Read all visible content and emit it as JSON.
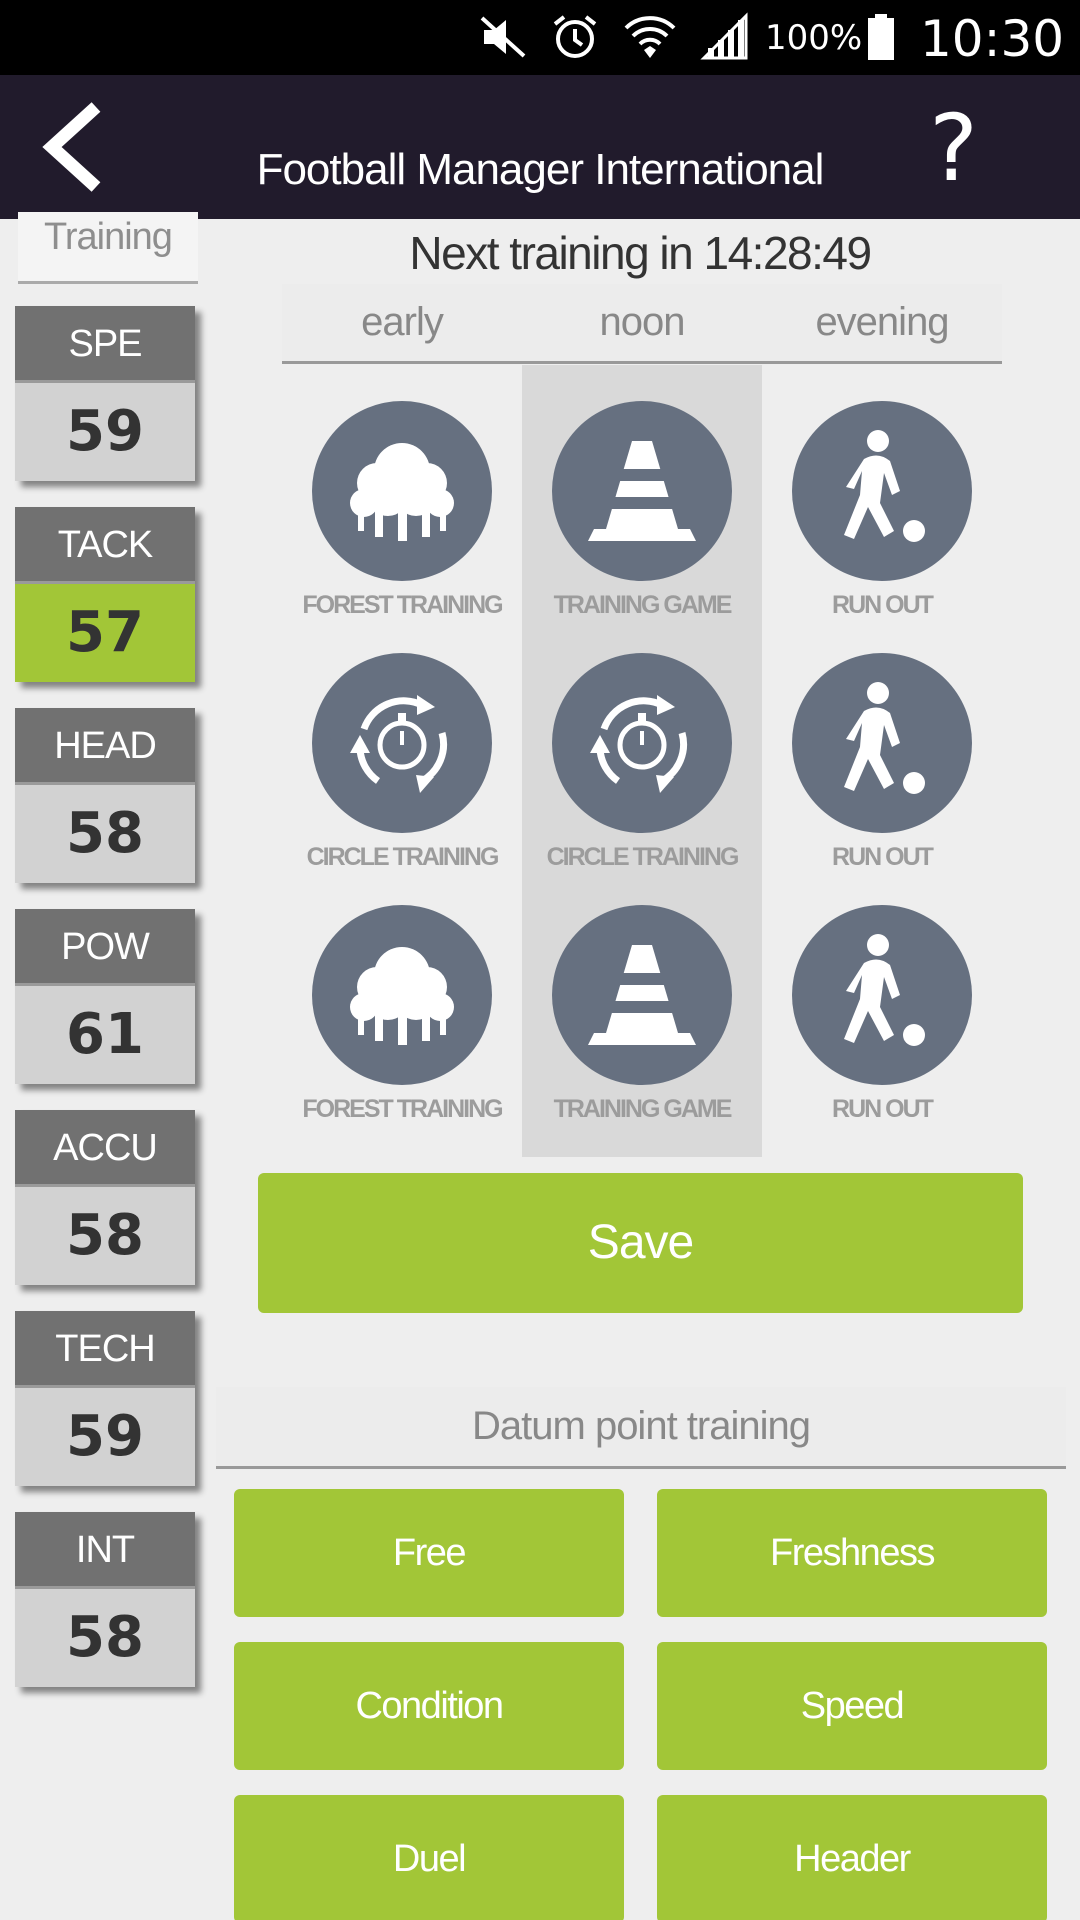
{
  "status_bar": {
    "battery": "100%",
    "time": "10:30",
    "icons": [
      "mute-icon",
      "alarm-icon",
      "wifi-icon",
      "signal-icon",
      "battery-icon"
    ]
  },
  "header": {
    "title": "Football Manager International",
    "help_label": "?"
  },
  "sidebar": {
    "title": "Training",
    "stats": [
      {
        "label": "SPE",
        "value": "59"
      },
      {
        "label": "TACK",
        "value": "57",
        "highlight": true
      },
      {
        "label": "HEAD",
        "value": "58"
      },
      {
        "label": "POW",
        "value": "61"
      },
      {
        "label": "ACCU",
        "value": "58"
      },
      {
        "label": "TECH",
        "value": "59"
      },
      {
        "label": "INT",
        "value": "58"
      }
    ]
  },
  "training": {
    "countdown": "Next training in 14:28:49",
    "slots": [
      "early",
      "noon",
      "evening"
    ],
    "selected_slot": "noon",
    "grid": [
      [
        {
          "icon": "trees-icon",
          "label": "FOREST TRAINING"
        },
        {
          "icon": "cone-icon",
          "label": "TRAINING GAME"
        },
        {
          "icon": "player-ball-icon",
          "label": "RUN OUT"
        }
      ],
      [
        {
          "icon": "stopwatch-cycle-icon",
          "label": "CIRCLE TRAINING"
        },
        {
          "icon": "stopwatch-cycle-icon",
          "label": "CIRCLE TRAINING"
        },
        {
          "icon": "player-ball-icon",
          "label": "RUN OUT"
        }
      ],
      [
        {
          "icon": "trees-icon",
          "label": "FOREST TRAINING"
        },
        {
          "icon": "cone-icon",
          "label": "TRAINING GAME"
        },
        {
          "icon": "player-ball-icon",
          "label": "RUN OUT"
        }
      ]
    ],
    "save_label": "Save"
  },
  "datum": {
    "title": "Datum point training",
    "buttons": [
      "Free",
      "Freshness",
      "Condition",
      "Speed",
      "Duel",
      "Header"
    ]
  },
  "colors": {
    "accent_green": "#a2c637",
    "header_bg": "#211b2c",
    "icon_circle": "#667080"
  }
}
